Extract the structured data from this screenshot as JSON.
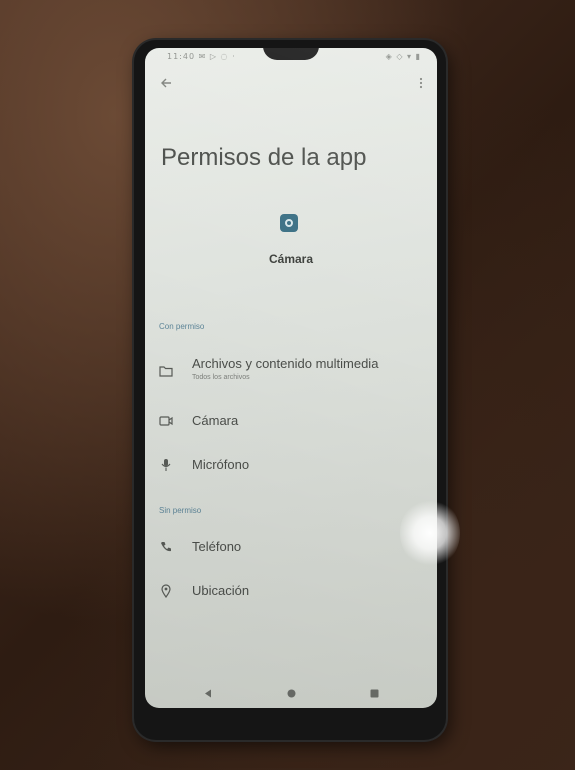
{
  "status_bar": {
    "left": "11:40 ✉ ▷ ◌ ·",
    "right": "◈ ◇ ▾ ▮"
  },
  "header": {
    "back_icon": "back-arrow-icon",
    "menu_icon": "overflow-menu-icon",
    "title": "Permisos de la app"
  },
  "app": {
    "icon": "camera-app-icon",
    "name": "Cámara"
  },
  "sections": {
    "allowed": {
      "header": "Con permiso",
      "items": [
        {
          "icon": "folder-icon",
          "label": "Archivos y contenido multimedia",
          "sublabel": "Todos los archivos"
        },
        {
          "icon": "camera-icon",
          "label": "Cámara"
        },
        {
          "icon": "microphone-icon",
          "label": "Micrófono"
        }
      ]
    },
    "denied": {
      "header": "Sin permiso",
      "items": [
        {
          "icon": "phone-icon",
          "label": "Teléfono"
        },
        {
          "icon": "location-icon",
          "label": "Ubicación"
        }
      ]
    }
  },
  "nav_bar": {
    "back": "back-triangle-icon",
    "home": "home-circle-icon",
    "recents": "recents-square-icon"
  },
  "colors": {
    "accent": "#5d8598",
    "app_icon": "#3a6f84",
    "screen_bg": "#dfe3de",
    "text_primary": "#4b4e4a"
  }
}
